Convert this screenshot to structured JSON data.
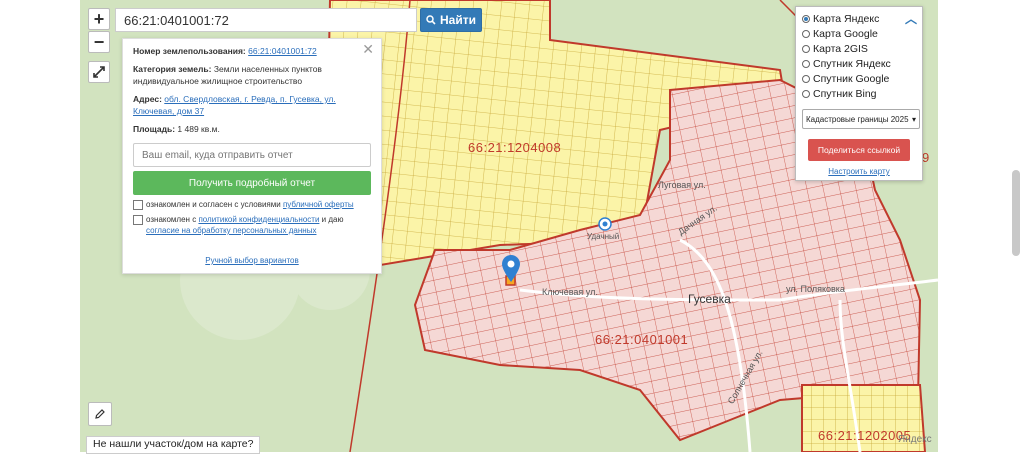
{
  "search": {
    "value": "66:21:0401001:72",
    "button_label": "Найти"
  },
  "zoom": {
    "in_label": "+",
    "out_label": "−"
  },
  "info_panel": {
    "number_label": "Номер землепользования:",
    "number_value": "66:21:0401001:72",
    "category_label": "Категория земель:",
    "category_value": "Земли населенных пунктов индивидуальное жилищное строительство",
    "address_label": "Адрес:",
    "address_value": "обл. Свердловская, г. Ревда, п. Гусевка, ул. Ключевая, дом 37",
    "area_label": "Площадь:",
    "area_value": "1 489 кв.м.",
    "email_placeholder": "Ваш email, куда отправить отчет",
    "report_button": "Получить подробный отчет",
    "consent1_text": "ознакомлен и согласен с условиями",
    "consent1_link": "публичной оферты",
    "consent2_text": "ознакомлен с",
    "consent2_link": "политикой конфиденциальности",
    "consent2_mid": "и даю",
    "consent2_link2": "согласие на обработку персональных данных",
    "manual_link": "Ручной выбор вариантов",
    "close_glyph": "✕"
  },
  "layers_panel": {
    "options": [
      {
        "label": "Карта Яндекс",
        "selected": true
      },
      {
        "label": "Карта Google",
        "selected": false
      },
      {
        "label": "Карта 2GIS",
        "selected": false
      },
      {
        "label": "Спутник Яндекс",
        "selected": false
      },
      {
        "label": "Спутник Google",
        "selected": false
      },
      {
        "label": "Спутник Bing",
        "selected": false
      }
    ],
    "select_value": "Кадастровые границы 2025",
    "share_button": "Поделиться ссылкой",
    "configure_link": "Настроить карту"
  },
  "map": {
    "cadastral_labels": [
      "66:21:1204008",
      "66:21:0401001",
      "66:21:1202005"
    ],
    "streets": [
      "Ключевая ул.",
      "Луговая ул.",
      "Дачная ул.",
      "Солнечная ул.",
      "ул. Поляковка"
    ],
    "town_label": "Гусевка",
    "poi_label": "Удачный",
    "watermark": "Яндекс",
    "edge_label": "9"
  },
  "bottom": {
    "not_found": "Не нашли участок/дом на карте?"
  },
  "colors": {
    "yellow_zone": "#fbf4a8",
    "parcel_fill": "#f5d8d5",
    "border": "#c0392b",
    "forest": "#d2e3bf"
  }
}
